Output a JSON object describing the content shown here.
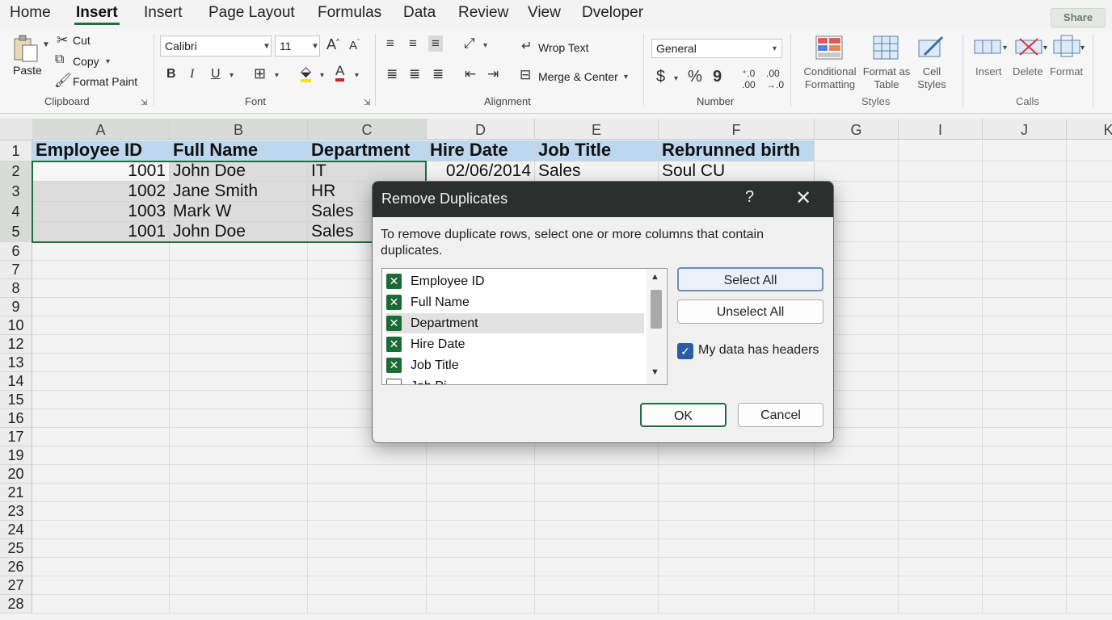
{
  "tabs": [
    "Home",
    "Insert",
    "Insert",
    "Page Layout",
    "Formulas",
    "Data",
    "Review",
    "View",
    "Dveloper"
  ],
  "share_label": "Share",
  "ribbon": {
    "clipboard": {
      "paste": "Paste",
      "cut": "Cut",
      "copy": "Copy",
      "format_paint": "Format Paint",
      "label": "Clipboard"
    },
    "font": {
      "name": "Calibri",
      "size": "11",
      "label": "Font",
      "bold": "B",
      "italic": "I",
      "underline": "U"
    },
    "alignment": {
      "wrap": "Wrop Text",
      "merge": "Merge & Center",
      "label": "Alignment"
    },
    "number": {
      "format": "General",
      "currency": "$",
      "percent": "%",
      "comma": "9",
      "label": "Number"
    },
    "styles": {
      "conditional": "Conditional Formatting",
      "table": "Format as Table",
      "cell": "Cell Styles",
      "label": "Styles"
    },
    "cells": {
      "insert": "Insert",
      "delete": "Delete",
      "format": "Format",
      "label": "Calls"
    }
  },
  "columns": [
    "A",
    "B",
    "C",
    "D",
    "E",
    "F",
    "G",
    "I",
    "J",
    "K"
  ],
  "rows": [
    "1",
    "2",
    "3",
    "4",
    "5",
    "6",
    "7",
    "8",
    "9",
    "10",
    "12",
    "13",
    "14",
    "15",
    "16",
    "17",
    "19",
    "20",
    "21",
    "23",
    "24",
    "25",
    "26",
    "27",
    "28"
  ],
  "sheet": {
    "headers": [
      "Employee ID",
      "Full Name",
      "Department",
      "Hire Date",
      "Job Title",
      "Rebrunned birth"
    ],
    "data": [
      [
        "1001",
        "John Doe",
        "IT",
        "02/06/2014",
        "Sales",
        "Soul CU"
      ],
      [
        "1002",
        "Jane Smith",
        "HR"
      ],
      [
        "1003",
        "Mark W",
        "Sales"
      ],
      [
        "1001",
        "John Doe",
        "Sales"
      ]
    ]
  },
  "dialog": {
    "title": "Remove Duplicates",
    "help": "?",
    "close": "✕",
    "instruction": "To remove duplicate rows, select one or more columns that contain duplicates.",
    "columns": [
      "Employee ID",
      "Full Name",
      "Department",
      "Hire Date",
      "Job Title",
      "Job Pi"
    ],
    "select_all": "Select All",
    "unselect_all": "Unselect All",
    "headers_label": "My data has headers",
    "headers_checked": true,
    "ok": "OK",
    "cancel": "Cancel"
  },
  "colors": {
    "accent": "#1e6e3e",
    "header_fill": "#bdd7ee",
    "selection": "#dcdcdc"
  }
}
